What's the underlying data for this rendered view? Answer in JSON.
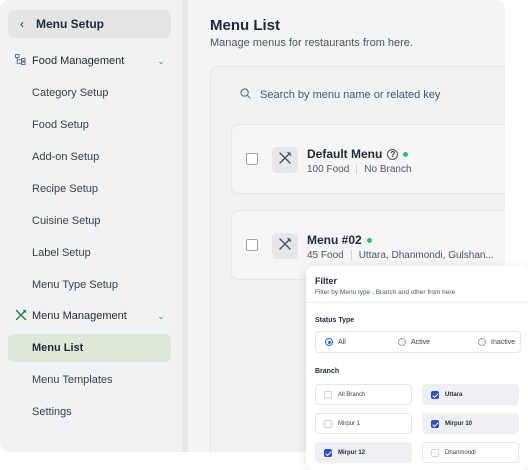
{
  "sidebar": {
    "header_title": "Menu Setup",
    "groups": [
      {
        "label": "Food Management",
        "icon": "hierarchy-icon",
        "items": [
          "Category Setup",
          "Food Setup",
          "Add-on Setup",
          "Recipe Setup",
          "Cuisine Setup",
          "Label Setup",
          "Menu Type Setup"
        ]
      },
      {
        "label": "Menu Management",
        "icon": "utensils-icon",
        "items": [
          "Menu List",
          "Menu Templates",
          "Settings"
        ]
      }
    ],
    "active_item": "Menu List",
    "active_color": "#dfe9d9"
  },
  "main": {
    "title": "Menu List",
    "subtitle": "Manage menus for restaurants from here.",
    "search_placeholder": "Search by menu name or related key",
    "menus": [
      {
        "name": "Default Menu",
        "food_count": "100 Food",
        "branches": "No Branch",
        "status": "active",
        "has_info": true
      },
      {
        "name": "Menu #02",
        "food_count": "45 Food",
        "branches": "Uttara, Dhanmondi, Gulshan...",
        "status": "active",
        "has_info": false
      }
    ],
    "status_color": "#22c55e"
  },
  "filter": {
    "title": "Filter",
    "subtitle": "Filter by Menu type , Branch and other from here",
    "status_label": "Status Type",
    "status_options": [
      "All",
      "Active",
      "Inactive"
    ],
    "status_selected": "All",
    "branch_label": "Branch",
    "branches": [
      {
        "label": "All Branch",
        "checked": false
      },
      {
        "label": "Uttara",
        "checked": true
      },
      {
        "label": "Mirpur 1",
        "checked": false
      },
      {
        "label": "Mirpur 10",
        "checked": true
      },
      {
        "label": "Mirpur 12",
        "checked": true
      },
      {
        "label": "Dhanmondi",
        "checked": false
      }
    ],
    "accent_color": "#2b50c8"
  }
}
